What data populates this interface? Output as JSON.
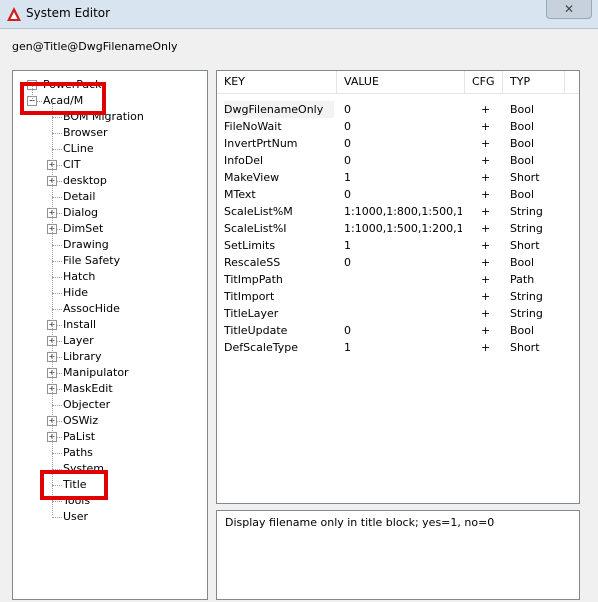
{
  "window": {
    "title": "System Editor",
    "close_glyph": "✕"
  },
  "path": "gen@Title@DwgFilenameOnly",
  "tree": {
    "items": [
      {
        "label": "PowerPack",
        "expander": "−"
      },
      {
        "label": "Acad/M",
        "expander": "−"
      },
      {
        "label": "BOM Migration",
        "expander": ""
      },
      {
        "label": "Browser",
        "expander": ""
      },
      {
        "label": "CLine",
        "expander": ""
      },
      {
        "label": "CIT",
        "expander": "+"
      },
      {
        "label": "desktop",
        "expander": "+"
      },
      {
        "label": "Detail",
        "expander": ""
      },
      {
        "label": "Dialog",
        "expander": "+"
      },
      {
        "label": "DimSet",
        "expander": "+"
      },
      {
        "label": "Drawing",
        "expander": ""
      },
      {
        "label": "File Safety",
        "expander": ""
      },
      {
        "label": "Hatch",
        "expander": ""
      },
      {
        "label": "Hide",
        "expander": ""
      },
      {
        "label": "AssocHide",
        "expander": ""
      },
      {
        "label": "Install",
        "expander": "+"
      },
      {
        "label": "Layer",
        "expander": "+"
      },
      {
        "label": "Library",
        "expander": "+"
      },
      {
        "label": "Manipulator",
        "expander": "+"
      },
      {
        "label": "MaskEdit",
        "expander": "+"
      },
      {
        "label": "Objecter",
        "expander": ""
      },
      {
        "label": "OSWiz",
        "expander": "+"
      },
      {
        "label": "PaList",
        "expander": "+"
      },
      {
        "label": "Paths",
        "expander": ""
      },
      {
        "label": "System",
        "expander": ""
      },
      {
        "label": "Title",
        "expander": ""
      },
      {
        "label": "Tools",
        "expander": ""
      },
      {
        "label": "User",
        "expander": ""
      }
    ]
  },
  "table": {
    "headers": [
      "KEY",
      "VALUE",
      "CFG",
      "TYP"
    ],
    "rows": [
      [
        "DwgFilenameOnly",
        "0",
        "+",
        "Bool"
      ],
      [
        "FileNoWait",
        "0",
        "+",
        "Bool"
      ],
      [
        "InvertPrtNum",
        "0",
        "+",
        "Bool"
      ],
      [
        "InfoDel",
        "0",
        "+",
        "Bool"
      ],
      [
        "MakeView",
        "1",
        "+",
        "Short"
      ],
      [
        "MText",
        "0",
        "+",
        "Bool"
      ],
      [
        "ScaleList%M",
        "1:1000,1:800,1:500,1...",
        "+",
        "String"
      ],
      [
        "ScaleList%I",
        "1:1000,1:500,1:200,1...",
        "+",
        "String"
      ],
      [
        "SetLimits",
        "1",
        "+",
        "Short"
      ],
      [
        "RescaleSS",
        "0",
        "+",
        "Bool"
      ],
      [
        "TitImpPath",
        "",
        "+",
        "Path"
      ],
      [
        "TitImport",
        "",
        "+",
        "String"
      ],
      [
        "TitleLayer",
        "",
        "+",
        "String"
      ],
      [
        "TitleUpdate",
        "0",
        "+",
        "Bool"
      ],
      [
        "DefScaleType",
        "1",
        "+",
        "Short"
      ]
    ]
  },
  "description": "Display filename only in title block; yes=1, no=0",
  "colors": {
    "highlight": "#e00000",
    "titlebar": "#d9e4f1"
  }
}
